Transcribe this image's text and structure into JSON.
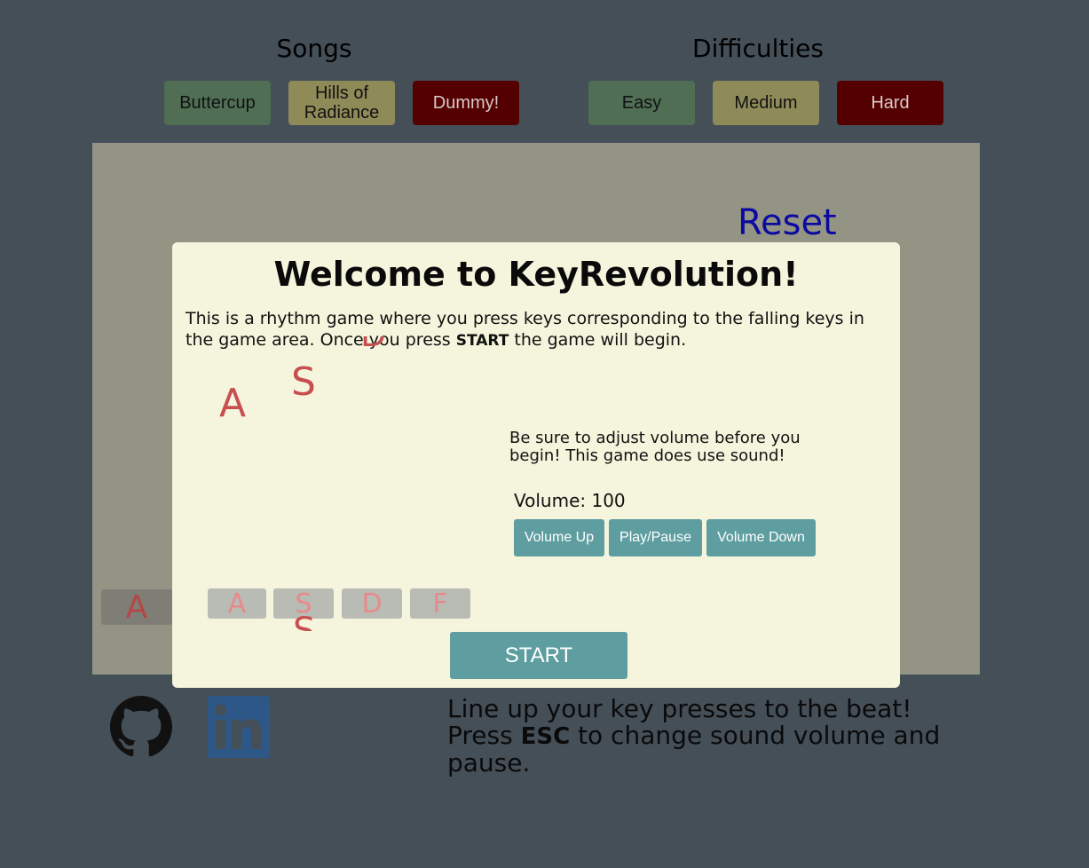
{
  "songs": {
    "title": "Songs",
    "items": [
      "Buttercup",
      "Hills of Radiance",
      "Dummy!"
    ]
  },
  "difficulties": {
    "title": "Difficulties",
    "items": [
      "Easy",
      "Medium",
      "Hard"
    ]
  },
  "game": {
    "reset_label": "Reset",
    "background_key": "A",
    "target_keys": [
      "A",
      "S",
      "D",
      "F"
    ],
    "falling_keys": [
      "A",
      "S",
      "D",
      "S"
    ]
  },
  "modal": {
    "title": "Welcome to KeyRevolution!",
    "desc_before": "This is a rhythm game where you press keys corresponding to the falling keys in the game area. Once you press ",
    "desc_bold": "START",
    "desc_after": " the game will begin.",
    "volume_note": "Be sure to adjust volume before you begin! This game does use sound!",
    "volume_label": "Volume: 100",
    "volume_up": "Volume Up",
    "play_pause": "Play/Pause",
    "volume_down": "Volume Down",
    "start_label": "START"
  },
  "footer": {
    "line1": "Line up your key presses to the beat!",
    "press": "Press ",
    "esc": "ESC",
    "rest": " to change sound volume and pause."
  },
  "colors": {
    "background": "#454f58",
    "game_area": "#949484",
    "modal": "#f4f5dc",
    "accent_button": "#5f9ea0",
    "reset_text": "#0a0aa0",
    "key_red": "#c84e50"
  },
  "icons": [
    "github-icon",
    "linkedin-icon"
  ]
}
